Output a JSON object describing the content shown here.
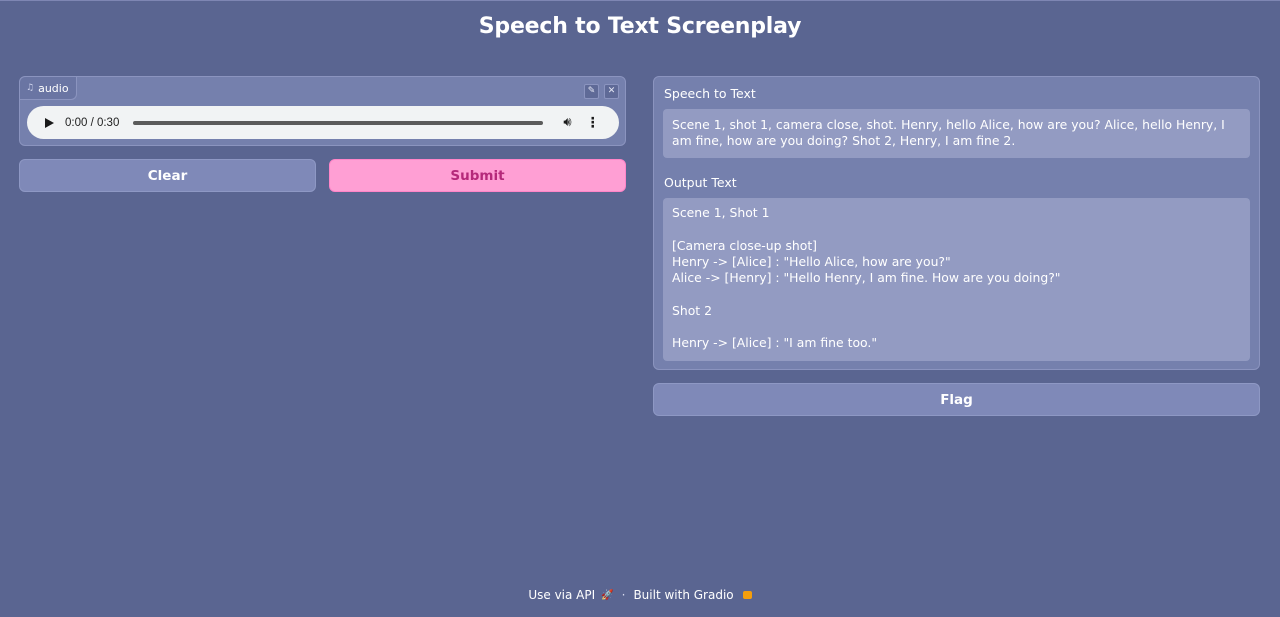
{
  "app": {
    "title": "Speech to Text Screenplay"
  },
  "audio_input": {
    "label": "audio",
    "label_icon": "music-icon",
    "edit_icon": "pencil-icon",
    "close_icon": "close-icon",
    "time": "0:00 / 0:30"
  },
  "buttons": {
    "clear": "Clear",
    "submit": "Submit",
    "flag": "Flag"
  },
  "speech_to_text": {
    "label": "Speech to Text",
    "value": "Scene 1, shot 1, camera close, shot. Henry, hello Alice, how are you? Alice, hello Henry, I am fine, how are you doing? Shot 2, Henry, I am fine 2."
  },
  "output_text": {
    "label": "Output Text",
    "value": "Scene 1, Shot 1\n\n[Camera close-up shot]\nHenry -> [Alice] : \"Hello Alice, how are you?\"\nAlice -> [Henry] : \"Hello Henry, I am fine. How are you doing?\"\n\nShot 2\n\nHenry -> [Alice] : \"I am fine too.\""
  },
  "footer": {
    "api_link": "Use via API",
    "separator": "·",
    "built_with": "Built with Gradio"
  },
  "colors": {
    "background": "#5a6591",
    "panel": "#7580ad",
    "submit": "#ff9fd4",
    "submit_text": "#b5297a"
  }
}
